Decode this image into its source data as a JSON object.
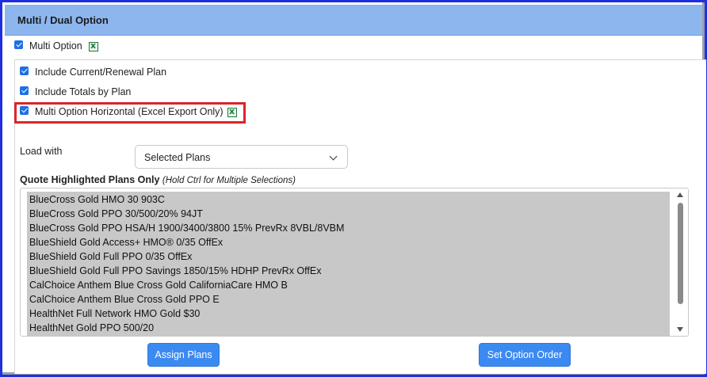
{
  "header": {
    "title": "Multi / Dual Option"
  },
  "multi_option": {
    "label": "Multi Option",
    "checked": true,
    "icon": "excel-icon"
  },
  "options": [
    {
      "label": "Include Current/Renewal Plan",
      "checked": true
    },
    {
      "label": "Include Totals by Plan",
      "checked": true
    },
    {
      "label": "Multi Option Horizontal (Excel Export Only)",
      "checked": true,
      "icon": "excel-icon"
    }
  ],
  "load_with": {
    "label": "Load with",
    "selected": "Selected Plans"
  },
  "plans_section": {
    "title": "Quote Highlighted Plans Only",
    "hint": "(Hold Ctrl for Multiple Selections)",
    "plans": [
      "BlueCross Gold HMO 30 903C",
      "BlueCross Gold PPO 30/500/20% 94JT",
      "BlueCross Gold PPO HSA/H 1900/3400/3800 15% PrevRx 8VBL/8VBM",
      "BlueShield Gold Access+ HMO® 0/35 OffEx",
      "BlueShield Gold Full PPO 0/35 OffEx",
      "BlueShield Gold Full PPO Savings 1850/15% HDHP PrevRx OffEx",
      "CalChoice Anthem Blue Cross Gold CaliforniaCare HMO B",
      "CalChoice Anthem Blue Cross Gold PPO E",
      "HealthNet Full Network HMO Gold $30",
      "HealthNet Gold PPO 500/20"
    ]
  },
  "buttons": {
    "assign": "Assign Plans",
    "order": "Set Option Order"
  },
  "colors": {
    "header_bg": "#8db6ef",
    "frame": "#1f2fe0",
    "highlight": "#d9262a",
    "button": "#3b8af2",
    "checkbox": "#1f6fe5"
  }
}
